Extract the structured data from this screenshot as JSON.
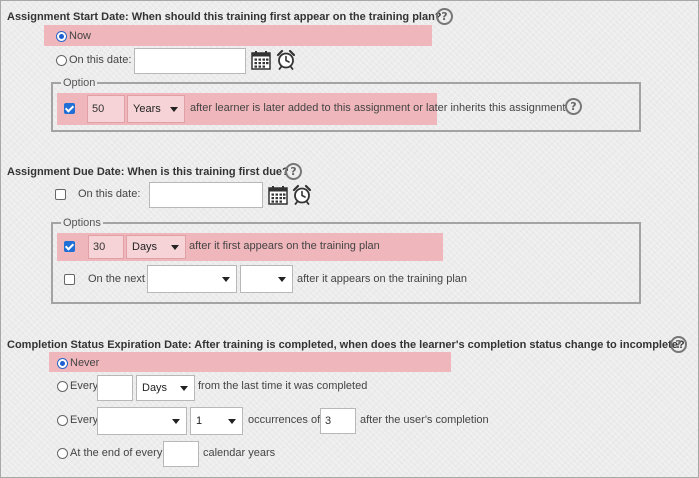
{
  "start": {
    "heading": "Assignment Start Date: When should this training first appear on the training plan?",
    "now_label": "Now",
    "on_date_label": "On this date:",
    "on_date_value": "",
    "option_legend": "Option",
    "option_value": "50",
    "option_unit": "Years",
    "option_text": "after learner is later added to this assignment or later inherits this assignment"
  },
  "due": {
    "heading": "Assignment Due Date: When is this training first due?",
    "on_date_label": "On this date:",
    "on_date_value": "",
    "options_legend": "Options",
    "opt1_value": "30",
    "opt1_unit": "Days",
    "opt1_text": "after it first appears on the training plan",
    "opt2_label": "On the next",
    "opt2_select1": "",
    "opt2_select2": "",
    "opt2_text": "after it appears on the training plan"
  },
  "completion": {
    "heading": "Completion Status Expiration Date: After training is completed, when does the learner's completion status change to incomplete?",
    "never_label": "Never",
    "every_label": "Every",
    "every_value": "",
    "every_unit": "Days",
    "every_text": "from the last time it was completed",
    "every2_label": "Every",
    "every2_select": "",
    "every2_count_select": "1",
    "occurrences_label": "occurrences of",
    "occurrences_value": "3",
    "after_completion_text": "after the user's completion",
    "end_of_every_label": "At the end of every",
    "end_of_every_value": "",
    "calendar_years_label": "calendar years"
  },
  "icons": {
    "help": "question-circle-icon",
    "calendar": "calendar-icon",
    "clock": "alarm-clock-icon"
  },
  "colors": {
    "highlight": "#efb6bb",
    "selected": "#1f5fd0"
  }
}
